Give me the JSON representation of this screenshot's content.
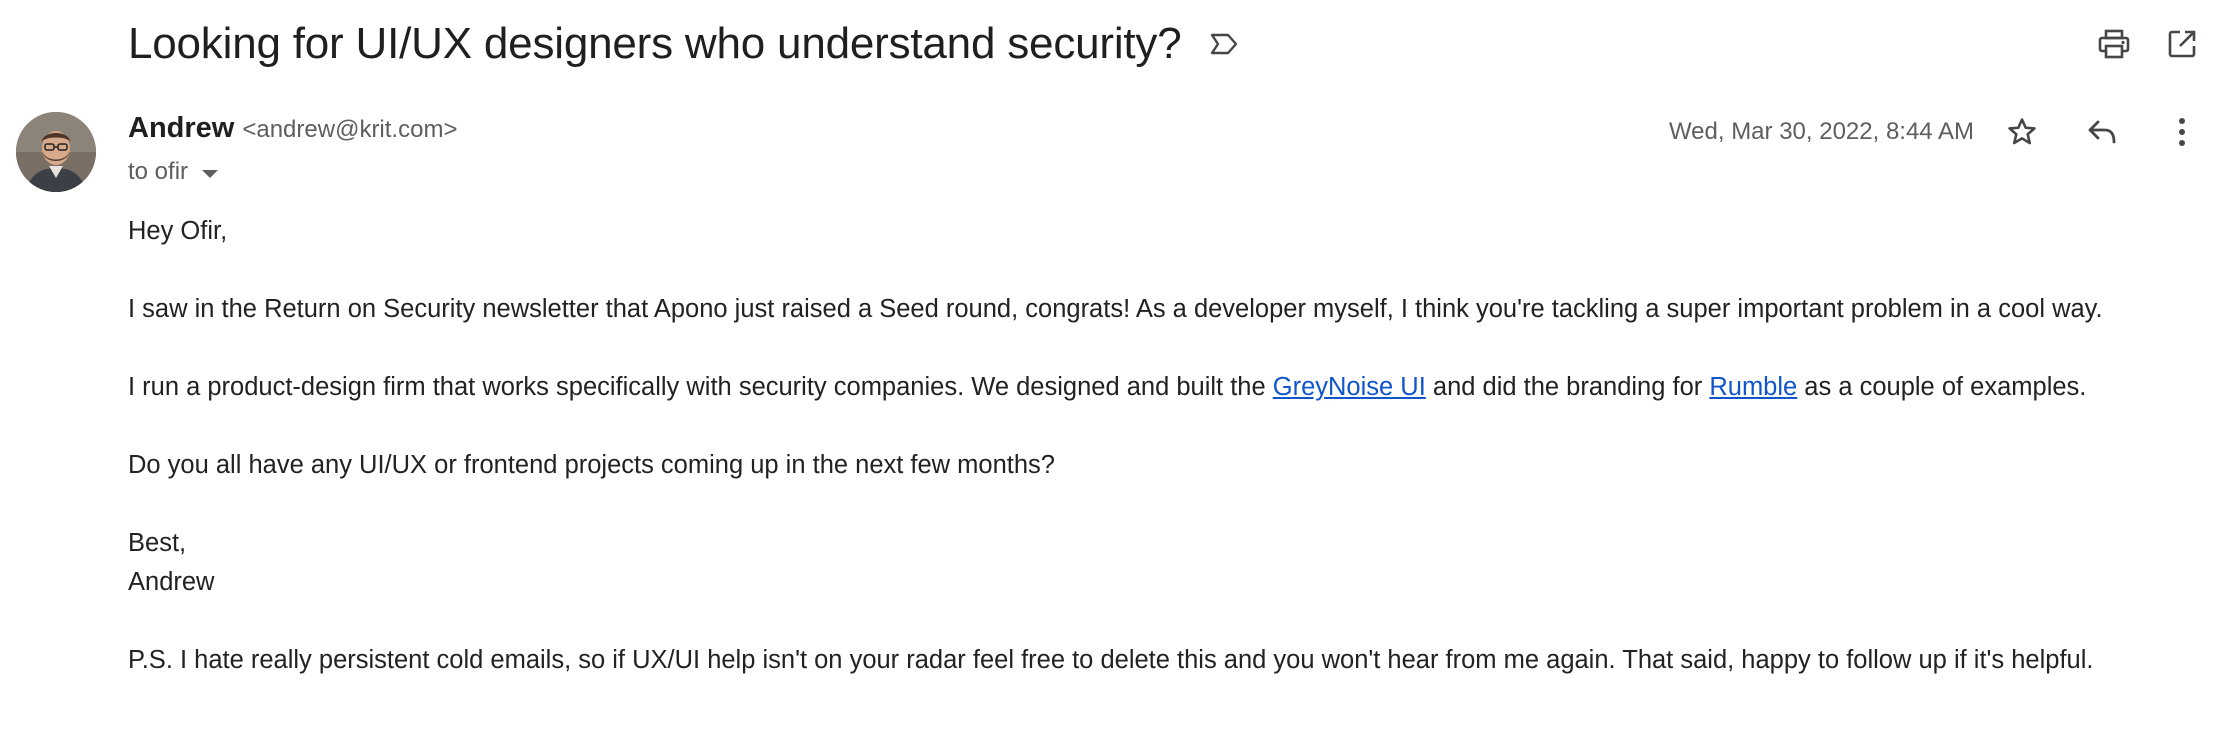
{
  "subject": "Looking for UI/UX designers who understand security?",
  "sender": {
    "name": "Andrew",
    "email": "<andrew@krit.com>",
    "to_label": "to ofir"
  },
  "date": "Wed, Mar 30, 2022, 8:44 AM",
  "icons": {
    "label": "label-outline-icon",
    "print": "print-icon",
    "open_new": "open-in-new-window-icon",
    "star": "star-outline-icon",
    "reply": "reply-icon",
    "more": "more-vertical-icon"
  },
  "body": {
    "greeting": "Hey Ofir,",
    "para1": "I saw in the Return on Security newsletter that Apono just raised a Seed round, congrats! As a developer myself, I think you're tackling a super important problem in a cool way.",
    "para2_a": "I run a product-design firm that works specifically with security companies. We designed and built the ",
    "link1": "GreyNoise UI",
    "para2_b": " and did the branding for ",
    "link2": "Rumble",
    "para2_c": " as a couple of examples.",
    "para3": "Do you all have any UI/UX or frontend projects coming up in the next few months?",
    "signoff": "Best,",
    "signature": "Andrew",
    "ps": "P.S. I hate really persistent cold emails, so if UX/UI help isn't on your radar feel free to delete this and you won't hear from me again. That said, happy to follow up if it's helpful."
  },
  "colors": {
    "link": "#1155cc",
    "icon": "#444746",
    "muted_text": "#5e5e5e"
  }
}
